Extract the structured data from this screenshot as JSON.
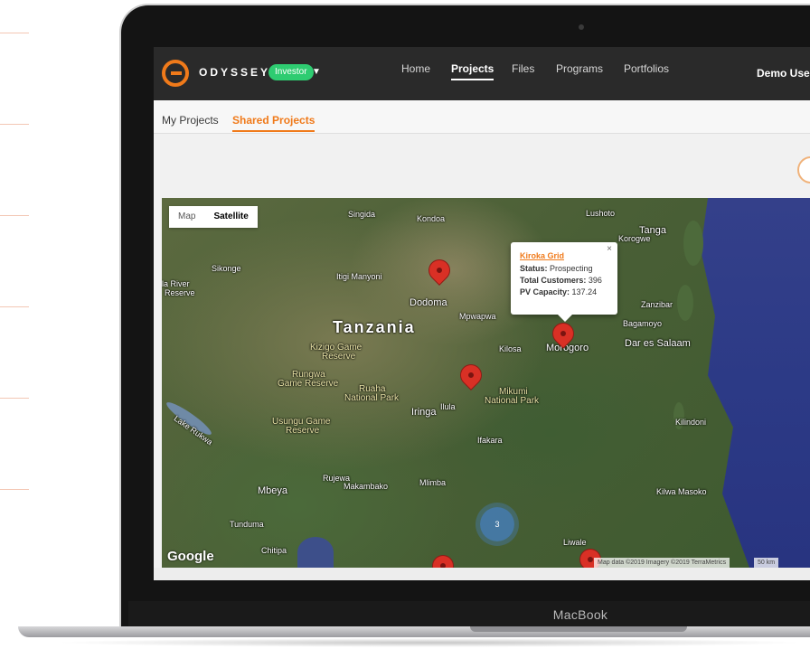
{
  "device": {
    "label": "MacBook"
  },
  "app": {
    "brand": "ODYSSEY",
    "role_badge": "Investor",
    "nav": [
      "Home",
      "Projects",
      "Files",
      "Programs",
      "Portfolios"
    ],
    "active_nav": "Projects",
    "user": "Demo User"
  },
  "subnav": {
    "tabs": [
      "My Projects",
      "Shared Projects"
    ],
    "active": "Shared Projects"
  },
  "map": {
    "type_buttons": [
      "Map",
      "Satellite"
    ],
    "selected_type": "Satellite",
    "country_label": "Tanzania",
    "labels": {
      "singida": "Singida",
      "kondoa": "Kondoa",
      "lushoto": "Lushoto",
      "korogwe": "Korogwe",
      "tanga": "Tanga",
      "sikonge": "Sikonge",
      "itigi": "Itigi Manyoni",
      "ruaha_river": "la River",
      "reserve_left": "Reserve",
      "dodoma": "Dodoma",
      "mpwapwa": "Mpwapwa",
      "zanzibar": "Zanzibar",
      "bagamoyo": "Bagamoyo",
      "kizigo": "Kizigo Game",
      "kizigo2": "Reserve",
      "kilosa": "Kilosa",
      "morogoro": "Morogoro",
      "dar": "Dar es Salaam",
      "rungwa": "Rungwa",
      "rungwa2": "Game Reserve",
      "ruaha": "Ruaha",
      "ruaha2": "National Park",
      "iringa": "Iringa",
      "ilula": "Ilula",
      "mikumi": "Mikumi",
      "mikumi2": "National Park",
      "usungu": "Usungu Game",
      "usungu2": "Reserve",
      "rukwa": "Lake Rukwa",
      "kilindoni": "Kilindoni",
      "ifakara": "Ifakara",
      "rujewa": "Rujewa",
      "makambako": "Makambako",
      "mlimba": "Mlimba",
      "mbeya": "Mbeya",
      "kilwa": "Kilwa Masoko",
      "tunduma": "Tunduma",
      "chitipa": "Chitipa",
      "liwale": "Liwale"
    },
    "cluster_count": "3",
    "info_window": {
      "title": "Kiroka Grid",
      "status_label": "Status:",
      "status_value": "Prospecting",
      "customers_label": "Total Customers:",
      "customers_value": "396",
      "pv_label": "PV Capacity:",
      "pv_value": "137.24",
      "close": "×"
    },
    "google_logo": "Google",
    "attribution": "Map data ©2019 Imagery ©2019 TerraMetrics",
    "scale": "50 km"
  }
}
